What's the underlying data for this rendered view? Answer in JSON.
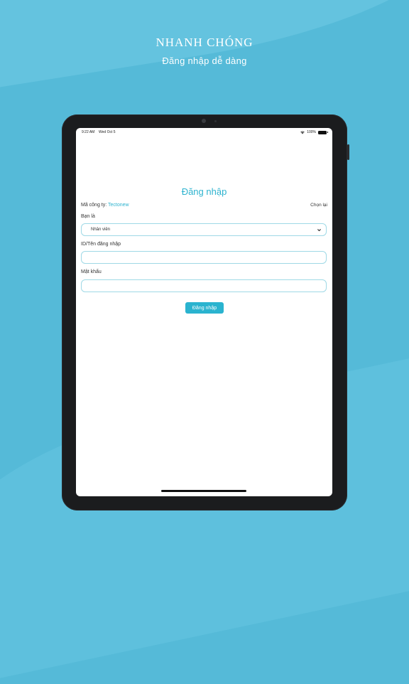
{
  "promo": {
    "headline": "NHANH CHÓNG",
    "subline": "Đăng nhập dễ dàng"
  },
  "statusbar": {
    "time": "9:22 AM",
    "date": "Wed Oct 5",
    "battery": "100%"
  },
  "login": {
    "title": "Đăng nhập",
    "company_label": "Mã công ty: ",
    "company_value": "Tectonew",
    "reselect": "Chọn lại",
    "role_label": "Bạn là",
    "role_value": "Nhân viên",
    "id_label": "ID/Tên đăng nhập",
    "id_value": "",
    "password_label": "Mật khẩu",
    "password_value": "",
    "submit": "Đăng nhập"
  },
  "colors": {
    "background": "#55bad8",
    "accent": "#2eb3cf",
    "device_bezel": "#1b1c1e"
  }
}
